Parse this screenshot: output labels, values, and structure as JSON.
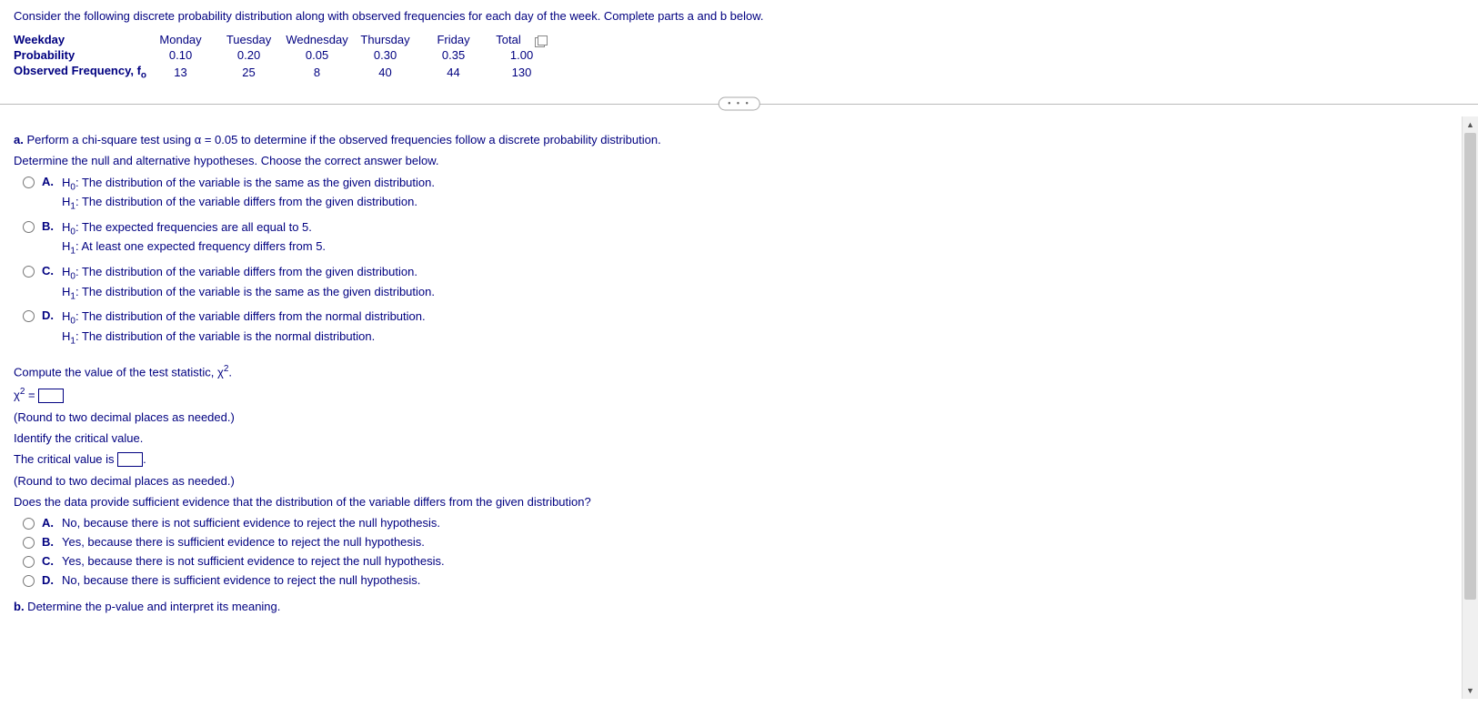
{
  "intro": "Consider the following discrete probability distribution along with observed frequencies for each day of the week. Complete parts a and b below.",
  "table": {
    "rows": [
      {
        "label": "Weekday",
        "cells": [
          "Monday",
          "Tuesday",
          "Wednesday",
          "Thursday",
          "Friday",
          "Total"
        ]
      },
      {
        "label": "Probability",
        "cells": [
          "0.10",
          "0.20",
          "0.05",
          "0.30",
          "0.35",
          "1.00"
        ]
      },
      {
        "label": "Observed Frequency, f",
        "sublabel": "o",
        "cells": [
          "13",
          "25",
          "8",
          "40",
          "44",
          "130"
        ]
      }
    ]
  },
  "partA": {
    "prompt_label": "a.",
    "prompt": " Perform a chi-square test using α = 0.05 to determine if the observed frequencies follow a discrete probability distribution.",
    "hyp_instruct": "Determine the null and alternative hypotheses. Choose the correct answer below.",
    "options1": [
      {
        "letter": "A.",
        "l1": "H",
        "s1": "0",
        "t1": ": The distribution of the variable is the same as the given distribution.",
        "l2": "H",
        "s2": "1",
        "t2": ": The distribution of the variable differs from the given distribution."
      },
      {
        "letter": "B.",
        "l1": "H",
        "s1": "0",
        "t1": ": The expected frequencies are all equal to 5.",
        "l2": "H",
        "s2": "1",
        "t2": ": At least one expected frequency differs from 5."
      },
      {
        "letter": "C.",
        "l1": "H",
        "s1": "0",
        "t1": ": The distribution of the variable differs from the given distribution.",
        "l2": "H",
        "s2": "1",
        "t2": ": The distribution of the variable is the same as the given distribution."
      },
      {
        "letter": "D.",
        "l1": "H",
        "s1": "0",
        "t1": ": The distribution of the variable differs from the normal distribution.",
        "l2": "H",
        "s2": "1",
        "t2": ": The distribution of the variable is the normal distribution."
      }
    ],
    "compute_instruct": "Compute the value of the test statistic, χ",
    "compute_sup": "2",
    "compute_period": ".",
    "chi_eq_pre": "χ",
    "chi_eq_sup": "2",
    "chi_eq_mid": " = ",
    "round_hint": "(Round to two decimal places as needed.)",
    "crit_instruct": "Identify the critical value.",
    "crit_text1": "The critical value is ",
    "crit_text2": ".",
    "evidence_q": "Does the data provide sufficient evidence that the distribution of the variable differs from the given distribution?",
    "options2": [
      {
        "letter": "A.",
        "text": "No, because there is not sufficient evidence to reject the null hypothesis."
      },
      {
        "letter": "B.",
        "text": "Yes, because there is sufficient evidence to reject the null hypothesis."
      },
      {
        "letter": "C.",
        "text": "Yes, because there is not sufficient evidence to reject the null hypothesis."
      },
      {
        "letter": "D.",
        "text": "No, because there is sufficient evidence to reject the null hypothesis."
      }
    ]
  },
  "partB": {
    "label": "b.",
    "text": " Determine the p-value and interpret its meaning."
  },
  "divider_dots": "• • •"
}
